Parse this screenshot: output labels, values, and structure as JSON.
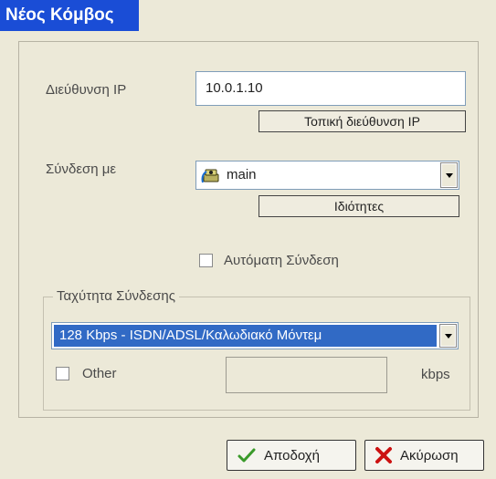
{
  "window": {
    "title": "Νέος Κόμβος"
  },
  "ip": {
    "label": "Διεύθυνση IP",
    "value": "10.0.1.10",
    "local_button": "Τοπική διεύθυνση IP"
  },
  "connection": {
    "label": "Σύνδεση με",
    "selected": "main",
    "properties_button": "Ιδιότητες"
  },
  "auto_connect": {
    "label": "Αυτόματη Σύνδεση",
    "checked": false
  },
  "speed": {
    "group_title": "Ταχύτητα Σύνδεσης",
    "selected": "128 Kbps - ISDN/ADSL/Καλωδιακό Μόντεμ",
    "other_label": "Other",
    "other_checked": false,
    "other_value": "",
    "unit": "kbps"
  },
  "buttons": {
    "ok": "Αποδοχή",
    "cancel": "Ακύρωση"
  },
  "colors": {
    "title_bg": "#1a4dd6",
    "selection_bg": "#316ac5",
    "window_bg": "#ece9d8",
    "ok_check": "#3a9a2a",
    "cancel_x": "#cc1111"
  }
}
